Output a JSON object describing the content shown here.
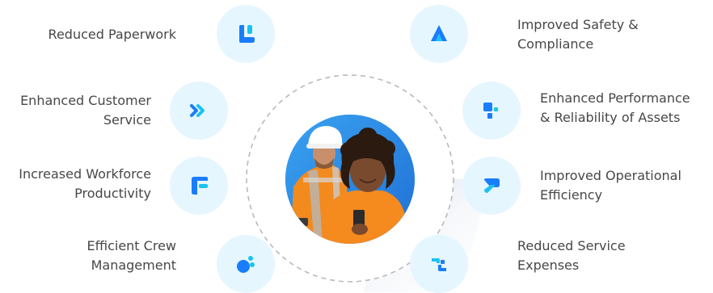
{
  "benefits": {
    "left": [
      {
        "label": "Reduced Paperwork",
        "icon": "document-icon"
      },
      {
        "label": "Enhanced Customer\nService",
        "icon": "double-chevron-right-icon"
      },
      {
        "label": "Increased Workforce\nProductivity",
        "icon": "form-icon"
      },
      {
        "label": "Efficient Crew\nManagement",
        "icon": "crew-dots-icon"
      }
    ],
    "right": [
      {
        "label": "Improved Safety &\nCompliance",
        "icon": "triangle-logo-icon"
      },
      {
        "label": "Enhanced Performance\n& Reliability of Assets",
        "icon": "grid-blocks-icon"
      },
      {
        "label": "Improved Operational\nEfficiency",
        "icon": "operation-icon"
      },
      {
        "label": "Reduced Service\nExpenses",
        "icon": "expense-icon"
      }
    ]
  },
  "colors": {
    "icon_bg": "#e6f6fe",
    "icon_blue": "#1a7dfb",
    "icon_cyan": "#19c3f2",
    "text": "#474747",
    "ring": "#b9b9b9"
  }
}
